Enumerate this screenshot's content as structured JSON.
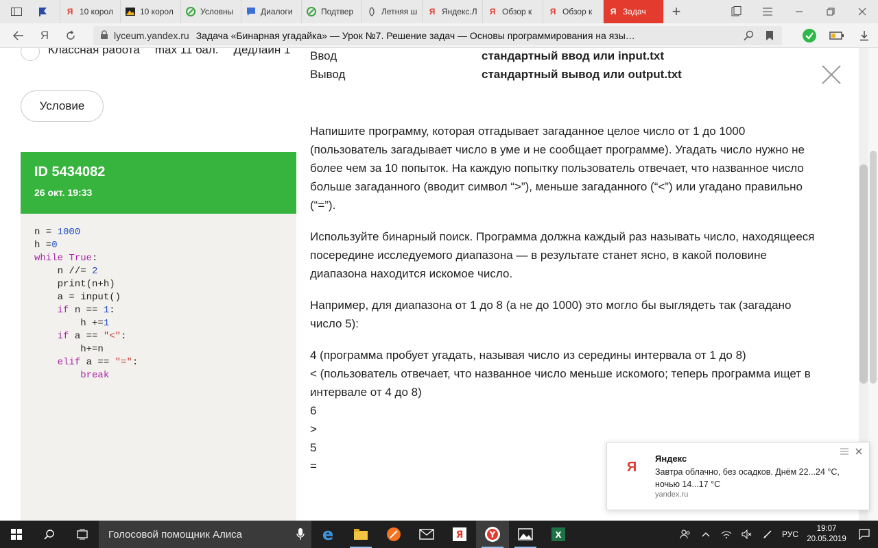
{
  "browser": {
    "tabs": [
      {
        "label": "",
        "icon": "flag-icon",
        "color": "#2b4aa3"
      },
      {
        "label": "10 корол",
        "icon": "yandex-icon",
        "color": "#e33b2e"
      },
      {
        "label": "10 корол",
        "icon": "photo-icon",
        "color": "#333333"
      },
      {
        "label": "Условны",
        "icon": "lyceum-icon",
        "color": "#3aa43f"
      },
      {
        "label": "Диалоги",
        "icon": "chat-icon",
        "color": "#3b6fd6"
      },
      {
        "label": "Подтвер",
        "icon": "lyceum-icon",
        "color": "#3aa43f"
      },
      {
        "label": "Летняя ш",
        "icon": "leaf-icon",
        "color": "#555555"
      },
      {
        "label": "Яндекс.Л",
        "icon": "yandex-icon",
        "color": "#e33b2e"
      },
      {
        "label": "Обзор к",
        "icon": "yandex-icon",
        "color": "#e33b2e"
      },
      {
        "label": "Обзор к",
        "icon": "yandex-icon",
        "color": "#e33b2e"
      },
      {
        "label": "Задач",
        "icon": "yandex-icon",
        "color": "#ffffff",
        "active": true
      }
    ],
    "yandex_glyph": "Я",
    "host": "lyceum.yandex.ru",
    "page_title": "Задача «Бинарная угадайка» — Урок №7. Решение задач — Основы программирования на язы…"
  },
  "lesson": {
    "classwork_label": "Классная работа",
    "max_score": "max 11 бал.",
    "deadline": "Дедлайн 1",
    "condition_button": "Условие"
  },
  "submission": {
    "id": "ID 5434082",
    "date": "26 окт. 19:33",
    "accent": "#37b43d"
  },
  "task": {
    "input_label": "Ввод",
    "input_value": "стандартный ввод или input.txt",
    "output_label": "Вывод",
    "output_value": "стандартный вывод или output.txt",
    "paragraph1": "Напишите программу, которая отгадывает загаданное целое число от 1 до 1000 (пользователь загадывает число в уме и не сообщает программе). Угадать число нужно не более чем за 10 попыток. На каждую попытку пользователь отвечает, что названное число больше загаданного (вводит символ “>”), меньше загаданного (“<”) или угадано правильно (“=”).",
    "paragraph2": "Используйте бинарный поиск. Программа должна каждый раз называть число, находящееся посередине исследуемого диапазона — в результате станет ясно, в какой половине диапазона находится искомое число.",
    "paragraph3": "Например, для диапазона от 1 до 8 (а не до 1000) это могло бы выглядеть так (загадано число 5):",
    "example": [
      "4 (программа пробует угадать, называя число из середины интервала от 1 до 8)",
      "< (пользователь отвечает, что названное число меньше искомого; теперь программа ищет в интервале от 4 до 8)",
      "6",
      ">",
      "5",
      "="
    ]
  },
  "notification": {
    "title": "Яндекс",
    "body": "Завтра облачно, без осадков. Днём 22...24 °C, ночью 14...17 °C",
    "source": "yandex.ru",
    "logo": "Я"
  },
  "taskbar": {
    "search_text": "Голосовой помощник Алиса",
    "language": "РУС",
    "time": "19:07",
    "date": "20.05.2019"
  }
}
